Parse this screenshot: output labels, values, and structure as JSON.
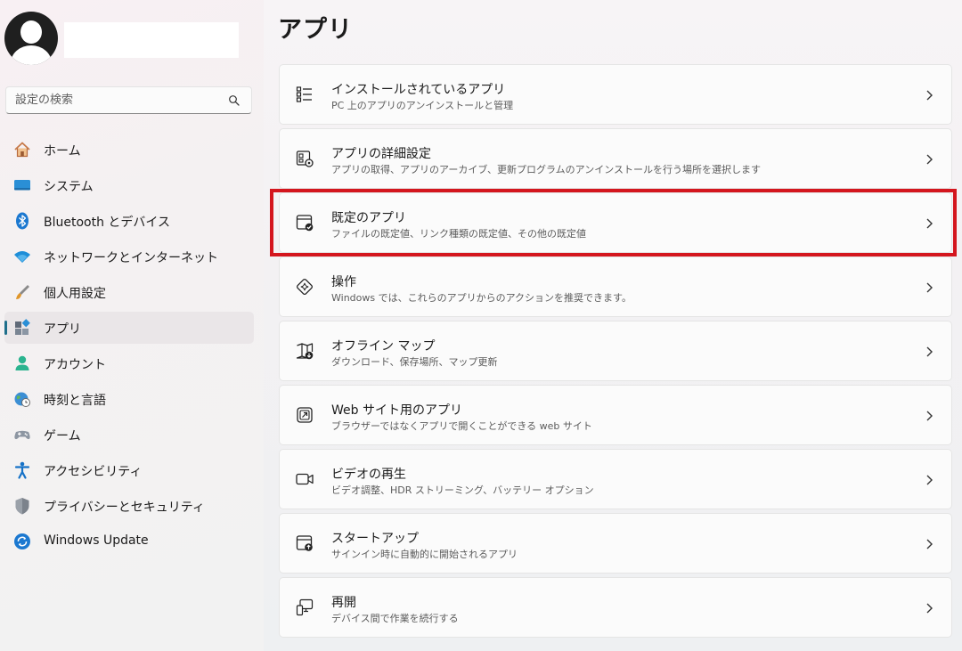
{
  "window": {
    "page_title": "アプリ"
  },
  "search": {
    "placeholder": "設定の検索"
  },
  "sidebar": {
    "items": [
      {
        "label": "ホーム",
        "icon": "home-icon",
        "active": false
      },
      {
        "label": "システム",
        "icon": "system-icon",
        "active": false
      },
      {
        "label": "Bluetooth とデバイス",
        "icon": "bluetooth-icon",
        "active": false
      },
      {
        "label": "ネットワークとインターネット",
        "icon": "wifi-icon",
        "active": false
      },
      {
        "label": "個人用設定",
        "icon": "brush-icon",
        "active": false
      },
      {
        "label": "アプリ",
        "icon": "apps-icon",
        "active": true
      },
      {
        "label": "アカウント",
        "icon": "account-icon",
        "active": false
      },
      {
        "label": "時刻と言語",
        "icon": "globe-clock-icon",
        "active": false
      },
      {
        "label": "ゲーム",
        "icon": "gamepad-icon",
        "active": false
      },
      {
        "label": "アクセシビリティ",
        "icon": "accessibility-icon",
        "active": false
      },
      {
        "label": "プライバシーとセキュリティ",
        "icon": "shield-icon",
        "active": false
      },
      {
        "label": "Windows Update",
        "icon": "update-icon",
        "active": false
      }
    ]
  },
  "main": {
    "cards": [
      {
        "title": "インストールされているアプリ",
        "description": "PC 上のアプリのアンインストールと管理",
        "icon": "installed-apps-icon"
      },
      {
        "title": "アプリの詳細設定",
        "description": "アプリの取得、アプリのアーカイブ、更新プログラムのアンインストールを行う場所を選択します",
        "icon": "advanced-app-settings-icon"
      },
      {
        "title": "既定のアプリ",
        "description": "ファイルの既定値、リンク種類の既定値、その他の既定値",
        "icon": "default-apps-icon",
        "highlighted": true
      },
      {
        "title": "操作",
        "description": "Windows では、これらのアプリからのアクションを推奨できます。",
        "icon": "actions-icon"
      },
      {
        "title": "オフライン マップ",
        "description": "ダウンロード、保存場所、マップ更新",
        "icon": "offline-map-icon"
      },
      {
        "title": "Web サイト用のアプリ",
        "description": "ブラウザーではなくアプリで開くことができる web サイト",
        "icon": "open-external-icon"
      },
      {
        "title": "ビデオの再生",
        "description": "ビデオ調整、HDR ストリーミング、バッテリー オプション",
        "icon": "video-icon"
      },
      {
        "title": "スタートアップ",
        "description": "サインイン時に自動的に開始されるアプリ",
        "icon": "startup-icon"
      },
      {
        "title": "再開",
        "description": "デバイス間で作業を続行する",
        "icon": "resume-icon"
      }
    ]
  },
  "colors": {
    "highlight_border": "#d4161e",
    "active_indicator": "#1f6f8b"
  }
}
